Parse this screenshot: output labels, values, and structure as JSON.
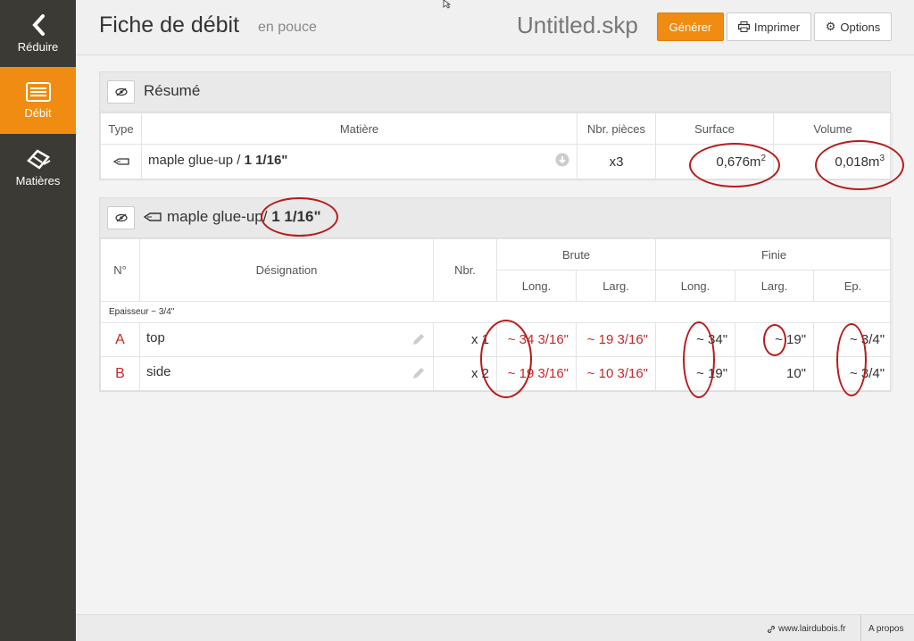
{
  "sidebar": {
    "items": [
      {
        "label": "Réduire",
        "icon": "chevron-left-icon"
      },
      {
        "label": "Débit",
        "icon": "list-icon"
      },
      {
        "label": "Matières",
        "icon": "material-icon"
      }
    ]
  },
  "header": {
    "title": "Fiche de débit",
    "subtitle": "en pouce",
    "filename": "Untitled.skp",
    "generate_label": "Générer",
    "print_label": "Imprimer",
    "options_label": "Options"
  },
  "summary": {
    "title": "Résumé",
    "columns": [
      "Type",
      "Matière",
      "Nbr. pièces",
      "Surface",
      "Volume"
    ],
    "row": {
      "material": "maple glue-up",
      "sep": " / ",
      "thickness": "1 1/16\"",
      "pieces": "x3",
      "surface": "0,676m",
      "surface_exp": "2",
      "volume": "0,018m",
      "volume_exp": "3"
    }
  },
  "detail": {
    "material": "maple glue-up",
    "sep": "/ ",
    "thickness": "1 1/16\"",
    "col_no": "N°",
    "col_designation": "Désignation",
    "col_count": "Nbr.",
    "col_brute": "Brute",
    "col_finie": "Finie",
    "col_long": "Long.",
    "col_larg": "Larg.",
    "col_ep": "Ep.",
    "group_label": "Epaisseur ~ 3/4\"",
    "rows": [
      {
        "id": "A",
        "name": "top",
        "count": "x 1",
        "brute_long": "~ 34 3/16\"",
        "brute_larg": "~ 19 3/16\"",
        "finie_long": "~ 34\"",
        "finie_larg": "~ 19\"",
        "finie_ep": "~ 3/4\""
      },
      {
        "id": "B",
        "name": "side",
        "count": "x 2",
        "brute_long": "~ 19 3/16\"",
        "brute_larg": "~ 10 3/16\"",
        "finie_long": "~ 19\"",
        "finie_larg": "10\"",
        "finie_ep": "~ 3/4\""
      }
    ]
  },
  "footer": {
    "link": "www.lairdubois.fr",
    "about": "A propos"
  }
}
